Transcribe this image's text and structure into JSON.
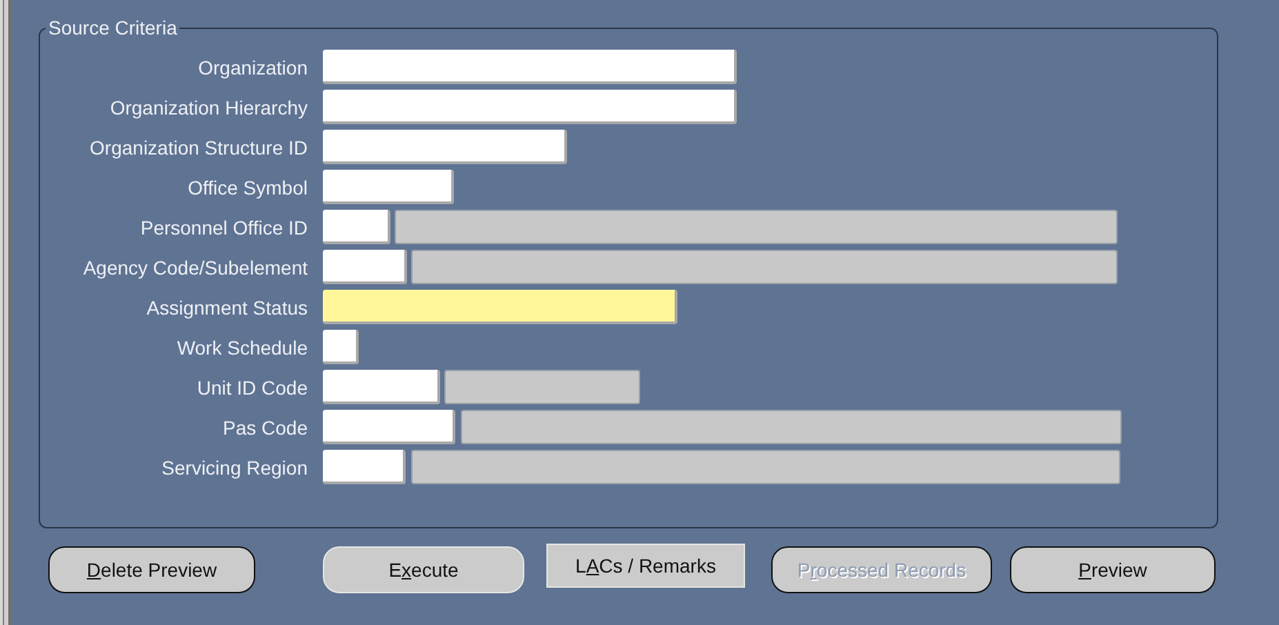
{
  "criteria": {
    "title": "Source Criteria",
    "rows": [
      {
        "label": "Organization",
        "fields": [
          {
            "kind": "input",
            "required": false
          }
        ]
      },
      {
        "label": "Organization Hierarchy",
        "fields": [
          {
            "kind": "input",
            "required": false
          }
        ]
      },
      {
        "label": "Organization Structure ID",
        "fields": [
          {
            "kind": "input",
            "required": false
          }
        ]
      },
      {
        "label": "Office Symbol",
        "fields": [
          {
            "kind": "input",
            "required": false
          }
        ]
      },
      {
        "label": "Personnel Office ID",
        "fields": [
          {
            "kind": "input",
            "required": false
          },
          {
            "kind": "display",
            "required": false
          }
        ]
      },
      {
        "label": "Agency Code/Subelement",
        "fields": [
          {
            "kind": "input",
            "required": false
          },
          {
            "kind": "display",
            "required": false
          }
        ]
      },
      {
        "label": "Assignment Status",
        "fields": [
          {
            "kind": "input",
            "required": true
          }
        ]
      },
      {
        "label": "Work Schedule",
        "fields": [
          {
            "kind": "input",
            "required": false
          }
        ]
      },
      {
        "label": "Unit ID Code",
        "fields": [
          {
            "kind": "input",
            "required": false
          },
          {
            "kind": "display",
            "required": false
          }
        ]
      },
      {
        "label": "Pas Code",
        "fields": [
          {
            "kind": "input",
            "required": false
          },
          {
            "kind": "display",
            "required": false
          }
        ]
      },
      {
        "label": "Servicing Region",
        "fields": [
          {
            "kind": "input",
            "required": false
          },
          {
            "kind": "display",
            "required": false
          }
        ]
      }
    ]
  },
  "buttons": [
    {
      "access_key": "D",
      "label_end": "elete Preview",
      "kind": "rounded",
      "emphasized": true,
      "disabled": false
    },
    {
      "label_start": "E",
      "access_key": "x",
      "label_end": "ecute",
      "kind": "rounded",
      "emphasized": false,
      "disabled": false
    },
    {
      "label_start": "L",
      "access_key": "A",
      "label_end": "Cs / Remarks",
      "kind": "flat",
      "emphasized": false,
      "disabled": false
    },
    {
      "label_start": "P",
      "access_key": "r",
      "label_end": "ocessed Records",
      "kind": "rounded",
      "emphasized": true,
      "disabled": true
    },
    {
      "access_key": "P",
      "label_end": "review",
      "kind": "rounded",
      "emphasized": true,
      "disabled": false
    }
  ]
}
